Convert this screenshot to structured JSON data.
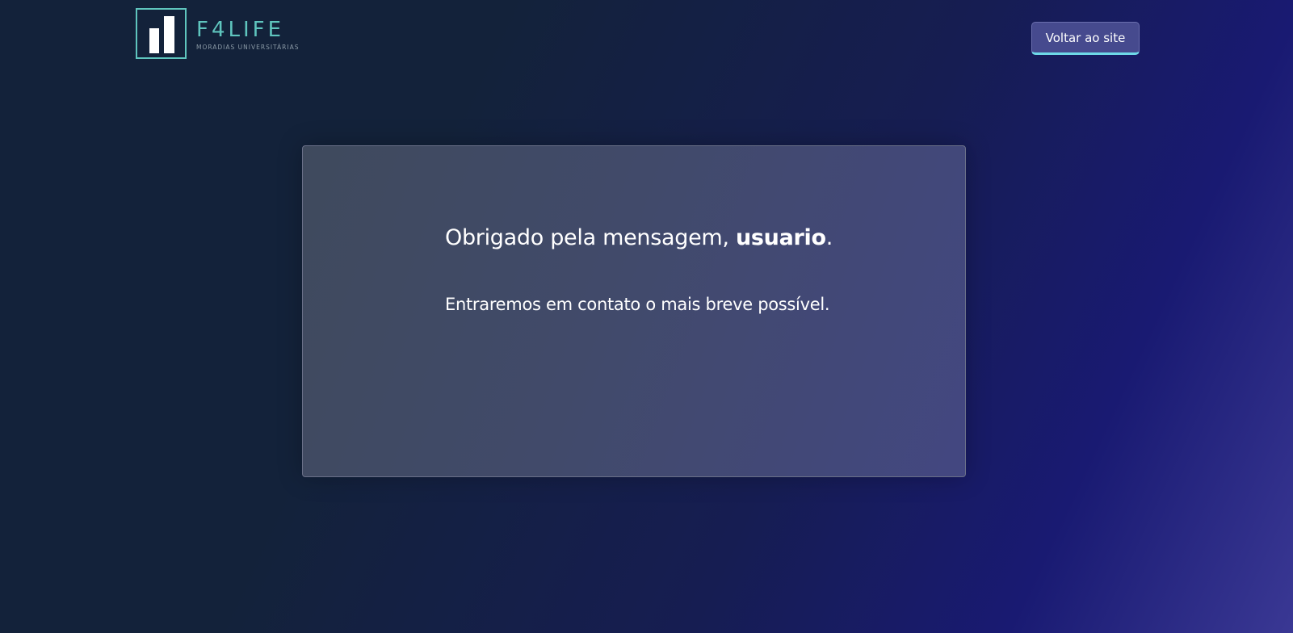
{
  "header": {
    "logo": {
      "title": "F4LIFE",
      "subtitle": "MORADIAS UNIVERSITÁRIAS",
      "icon": "bar-chart-logo-icon"
    },
    "back_button_label": "Voltar ao site"
  },
  "card": {
    "thanks_prefix": "Obrigado pela mensagem, ",
    "user_name": "usuario",
    "thanks_suffix": ".",
    "message": "Entraremos em contato o mais breve possível."
  },
  "colors": {
    "accent": "#5fc5be",
    "button_bg": "#464a8e",
    "button_underline": "#6ed9e8"
  }
}
